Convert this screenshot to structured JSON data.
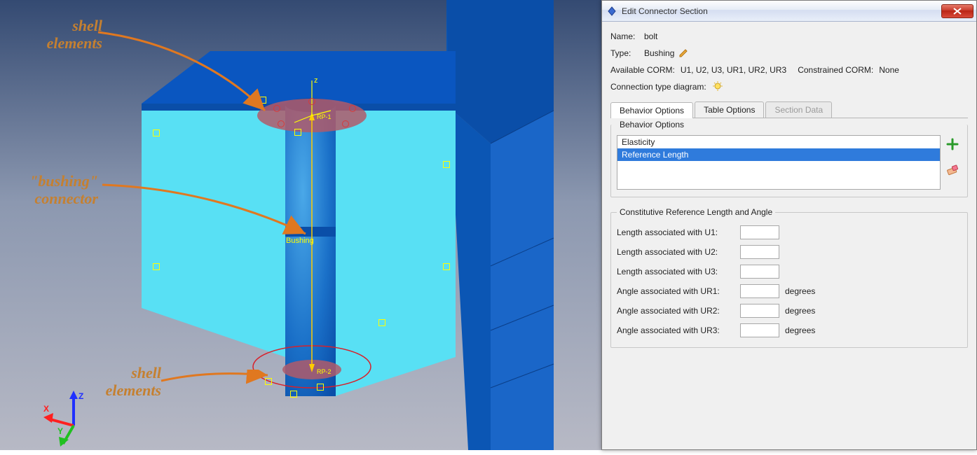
{
  "annotations": {
    "shell_top": "shell\nelements",
    "bushing": "\"bushing\"\nconnector",
    "shell_bot": "shell\nelements"
  },
  "scene": {
    "bushing_label": "Bushing",
    "axes": {
      "x": "X",
      "y": "Y",
      "z": "Z"
    },
    "coord_z": "z"
  },
  "dialog": {
    "title": "Edit Connector Section",
    "name_label": "Name:",
    "name_value": "bolt",
    "type_label": "Type:",
    "type_value": "Bushing",
    "avail_corm_label": "Available CORM:",
    "avail_corm_value": "U1, U2, U3, UR1, UR2, UR3",
    "constr_corm_label": "Constrained CORM:",
    "constr_corm_value": "None",
    "conn_diagram_label": "Connection type diagram:",
    "tabs": {
      "behavior": "Behavior Options",
      "table": "Table Options",
      "section": "Section Data"
    },
    "group_behavior": "Behavior Options",
    "behavior_items": {
      "elasticity": "Elasticity",
      "ref_length": "Reference Length"
    },
    "group_constitutive": "Constitutive Reference Length and Angle",
    "form": {
      "u1": "Length associated with U1:",
      "u2": "Length associated with U2:",
      "u3": "Length associated with U3:",
      "ur1": "Angle associated with UR1:",
      "ur2": "Angle associated with UR2:",
      "ur3": "Angle associated with UR3:",
      "unit_deg": "degrees"
    }
  }
}
